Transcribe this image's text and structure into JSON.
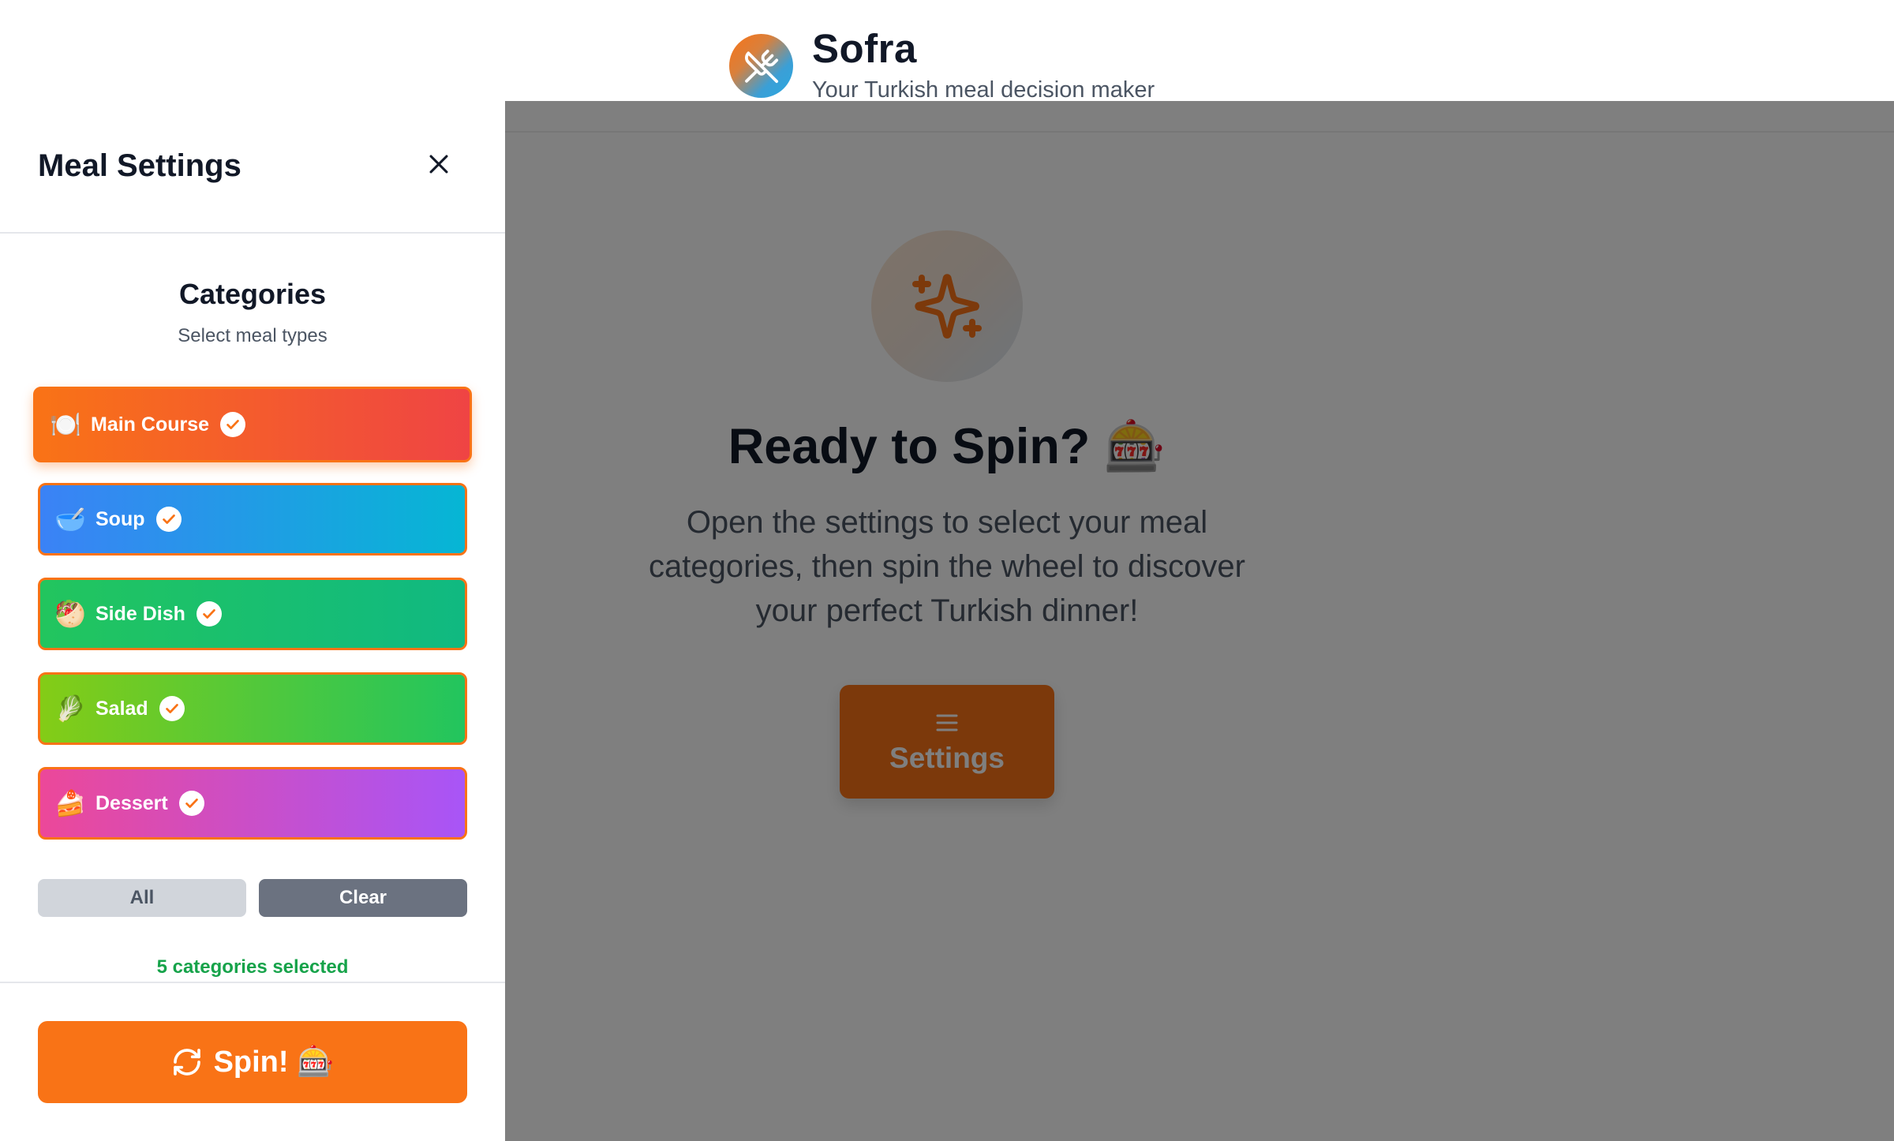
{
  "header": {
    "title": "Sofra",
    "subtitle": "Your Turkish meal decision maker",
    "logo_icon": "fork-knife-icon"
  },
  "main": {
    "hero_icon": "sparkles-icon",
    "title": "Ready to Spin? 🎰",
    "description": "Open the settings to select your meal categories, then spin the wheel to discover your perfect Turkish dinner!",
    "settings_button": "Settings",
    "settings_icon": "menu-icon"
  },
  "drawer": {
    "title": "Meal Settings",
    "close_icon": "close-icon",
    "categories_heading": "Categories",
    "categories_subtitle": "Select meal types",
    "categories": [
      {
        "emoji": "🍽️",
        "label": "Main Course",
        "selected": true,
        "colors": [
          "#f97316",
          "#ef4444"
        ]
      },
      {
        "emoji": "🥣",
        "label": "Soup",
        "selected": true,
        "colors": [
          "#3b82f6",
          "#06b6d4"
        ]
      },
      {
        "emoji": "🥙",
        "label": "Side Dish",
        "selected": true,
        "colors": [
          "#22c55e",
          "#10b981"
        ]
      },
      {
        "emoji": "🥬",
        "label": "Salad",
        "selected": true,
        "colors": [
          "#84cc16",
          "#22c55e"
        ]
      },
      {
        "emoji": "🍰",
        "label": "Dessert",
        "selected": true,
        "colors": [
          "#ec4899",
          "#a855f7"
        ]
      }
    ],
    "all_button": "All",
    "clear_button": "Clear",
    "selection_count": "5 categories selected",
    "spin_button": "Spin! 🎰",
    "spin_icon": "refresh-icon"
  },
  "colors": {
    "accent": "#f97316",
    "success": "#16a34a",
    "overlay": "rgba(0,0,0,0.5)"
  }
}
